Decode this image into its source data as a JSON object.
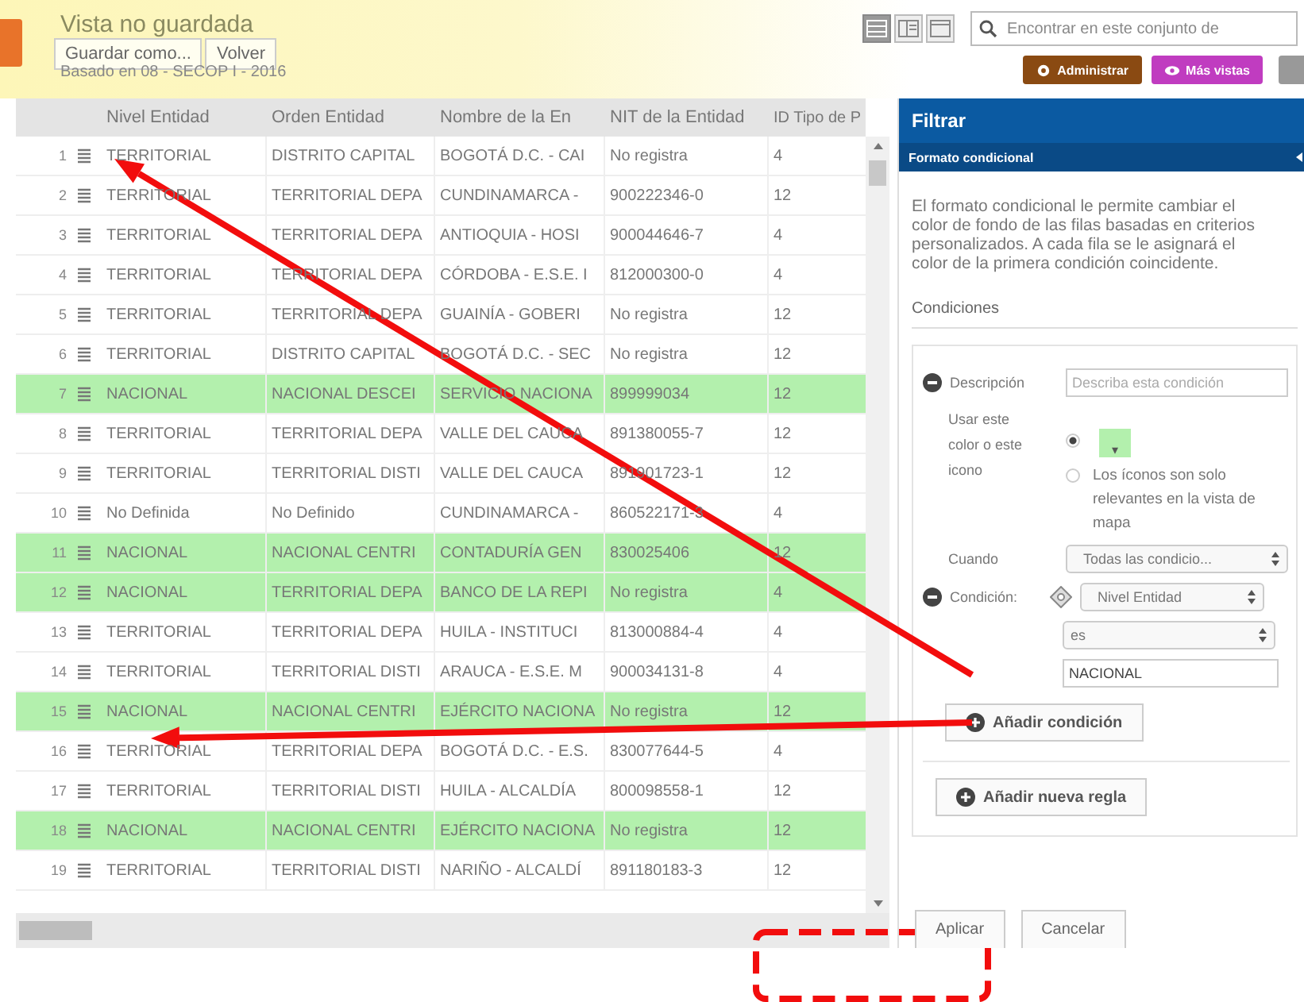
{
  "header": {
    "title": "Vista no guardada",
    "buttons": [
      "Guardar como...",
      "Volver"
    ],
    "subtitle": "Basado en 08 - SECOP I - 2016"
  },
  "toolbar": {
    "view_modes": [
      {
        "kind": "table",
        "selected": true
      },
      {
        "kind": "split",
        "selected": false
      },
      {
        "kind": "page",
        "selected": false
      }
    ],
    "search": {
      "placeholder": "Encontrar en este conjunto de"
    },
    "buttons": [
      {
        "kind": "manage",
        "label": "Administrar"
      },
      {
        "kind": "views",
        "label": "Más vistas"
      },
      {
        "kind": "more"
      }
    ]
  },
  "table": {
    "columns": [
      "Nivel Entidad",
      "Orden Entidad",
      "Nombre de la En",
      "NIT de la Entidad",
      "ID Tipo de P"
    ],
    "rows": [
      {
        "number": "1",
        "highlighted": false,
        "cells": [
          "TERRITORIAL",
          "DISTRITO CAPITAL",
          "BOGOTÁ D.C. - CAI",
          "No registra",
          "4"
        ]
      },
      {
        "number": "2",
        "highlighted": false,
        "cells": [
          "TERRITORIAL",
          "TERRITORIAL DEPA",
          "CUNDINAMARCA -",
          "900222346-0",
          "12"
        ]
      },
      {
        "number": "3",
        "highlighted": false,
        "cells": [
          "TERRITORIAL",
          "TERRITORIAL DEPA",
          "ANTIOQUIA - HOSI",
          "900044646-7",
          "4"
        ]
      },
      {
        "number": "4",
        "highlighted": false,
        "cells": [
          "TERRITORIAL",
          "TERRITORIAL DEPA",
          "CÓRDOBA - E.S.E. I",
          "812000300-0",
          "4"
        ]
      },
      {
        "number": "5",
        "highlighted": false,
        "cells": [
          "TERRITORIAL",
          "TERRITORIAL DEPA",
          "GUAINÍA - GOBERI",
          "No registra",
          "12"
        ]
      },
      {
        "number": "6",
        "highlighted": false,
        "cells": [
          "TERRITORIAL",
          "DISTRITO CAPITAL",
          "BOGOTÁ D.C. - SEC",
          "No registra",
          "12"
        ]
      },
      {
        "number": "7",
        "highlighted": true,
        "cells": [
          "NACIONAL",
          "NACIONAL DESCEI",
          "SERVICIO NACIONA",
          "899999034",
          "12"
        ]
      },
      {
        "number": "8",
        "highlighted": false,
        "cells": [
          "TERRITORIAL",
          "TERRITORIAL DEPA",
          "VALLE DEL CAUCA",
          "891380055-7",
          "12"
        ]
      },
      {
        "number": "9",
        "highlighted": false,
        "cells": [
          "TERRITORIAL",
          "TERRITORIAL DISTI",
          "VALLE DEL CAUCA",
          "891901723-1",
          "12"
        ]
      },
      {
        "number": "10",
        "highlighted": false,
        "cells": [
          "No Definida",
          "No Definido",
          "CUNDINAMARCA -",
          "860522171-3",
          "4"
        ]
      },
      {
        "number": "11",
        "highlighted": true,
        "cells": [
          "NACIONAL",
          "NACIONAL CENTRI",
          "CONTADURÍA GEN",
          "830025406",
          "12"
        ]
      },
      {
        "number": "12",
        "highlighted": true,
        "cells": [
          "NACIONAL",
          "TERRITORIAL DEPA",
          "BANCO DE LA REPI",
          "No registra",
          "4"
        ]
      },
      {
        "number": "13",
        "highlighted": false,
        "cells": [
          "TERRITORIAL",
          "TERRITORIAL DEPA",
          "HUILA - INSTITUCI",
          "813000884-4",
          "4"
        ]
      },
      {
        "number": "14",
        "highlighted": false,
        "cells": [
          "TERRITORIAL",
          "TERRITORIAL DISTI",
          "ARAUCA - E.S.E. M",
          "900034131-8",
          "4"
        ]
      },
      {
        "number": "15",
        "highlighted": true,
        "cells": [
          "NACIONAL",
          "NACIONAL CENTRI",
          "EJÉRCITO NACIONA",
          "No registra",
          "12"
        ]
      },
      {
        "number": "16",
        "highlighted": false,
        "cells": [
          "TERRITORIAL",
          "TERRITORIAL DEPA",
          "BOGOTÁ D.C. - E.S.",
          "830077644-5",
          "4"
        ]
      },
      {
        "number": "17",
        "highlighted": false,
        "cells": [
          "TERRITORIAL",
          "TERRITORIAL DISTI",
          "HUILA - ALCALDÍA",
          "800098558-1",
          "12"
        ]
      },
      {
        "number": "18",
        "highlighted": true,
        "cells": [
          "NACIONAL",
          "NACIONAL CENTRI",
          "EJÉRCITO NACIONA",
          "No registra",
          "12"
        ]
      },
      {
        "number": "19",
        "highlighted": false,
        "cells": [
          "TERRITORIAL",
          "TERRITORIAL DISTI",
          "NARIÑO - ALCALDÍ",
          "891180183-3",
          "12"
        ]
      }
    ]
  },
  "panel": {
    "title": "Filtrar",
    "section": "Formato condicional",
    "intro": "El formato condicional le permite cambiar el color de fondo de las filas basadas en criterios personalizados. A cada fila se le asignará el color de la primera condición coincidente.",
    "conditions_heading": "Condiciones",
    "rule": {
      "description_label": "Descripción",
      "description_placeholder": "Describa esta condición",
      "use_label": "Usar este color o este icono",
      "color_option": {
        "selected": true,
        "color": "#b3f0ad",
        "caret": "▾"
      },
      "icon_option": {
        "selected": false,
        "note": "Los íconos son solo relevantes en la vista de mapa"
      },
      "when_label": "Cuando",
      "when_value": "Todas las condicio...",
      "condition_label": "Condición:",
      "column_value": "Nivel Entidad",
      "operator_value": "es",
      "value": "NACIONAL",
      "add_condition": "Añadir condición"
    },
    "add_rule": "Añadir nueva regla",
    "buttons": [
      "Aplicar",
      "Cancelar"
    ]
  },
  "annotations": [
    {
      "kind": "arrow"
    },
    {
      "kind": "arrow"
    },
    {
      "kind": "dashed-box"
    }
  ]
}
